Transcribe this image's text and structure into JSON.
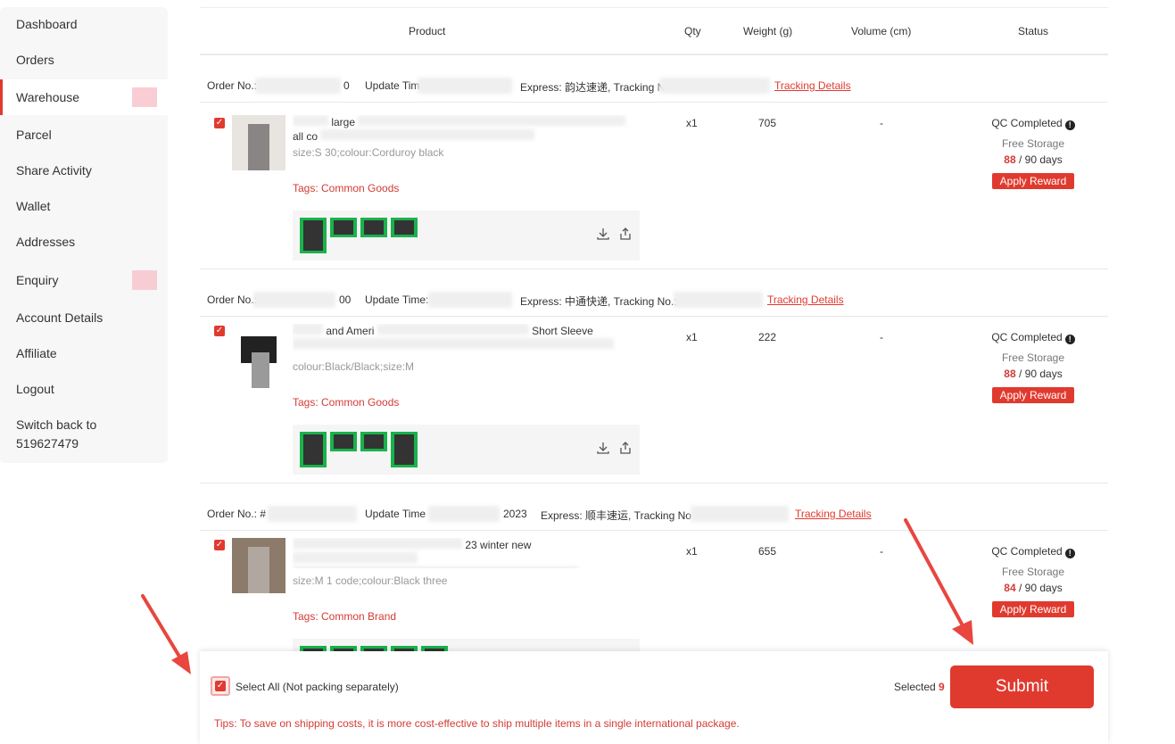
{
  "sidebar": {
    "items": [
      {
        "label": "Dashboard"
      },
      {
        "label": "Orders"
      },
      {
        "label": "Warehouse"
      },
      {
        "label": "Parcel"
      },
      {
        "label": "Share Activity"
      },
      {
        "label": "Wallet"
      },
      {
        "label": "Addresses"
      },
      {
        "label": "Enquiry"
      },
      {
        "label": "Account Details"
      },
      {
        "label": "Affiliate"
      },
      {
        "label": "Logout"
      },
      {
        "label": "Switch back to 519627479"
      }
    ]
  },
  "table": {
    "headers": {
      "product": "Product",
      "qty": "Qty",
      "weight": "Weight (g)",
      "volume": "Volume (cm)",
      "status": "Status"
    }
  },
  "orders": [
    {
      "order_no_label": "Order No.:",
      "order_no_tail": "0",
      "update_label": "Update Tim",
      "express": "Express: 韵达速递, Tracking N",
      "tracking_link": "Tracking Details",
      "product_title_visible": "large",
      "product_title_line2": "all co",
      "spec": "size:S 30;colour:Corduroy black",
      "tags": "Tags: Common Goods",
      "qty": "x1",
      "weight": "705",
      "volume": "-",
      "status": "QC Completed",
      "storage": "Free Storage",
      "days_used": "88",
      "days_total": " / 90 days",
      "apply_label": "Apply Reward"
    },
    {
      "order_no_label": "Order No.:",
      "order_no_tail": "00",
      "update_label": "Update Time:",
      "express": "Express: 中通快递, Tracking No.:",
      "tracking_link": "Tracking Details",
      "product_title_visible": "and Ameri",
      "product_title_line2": "Short Sleeve",
      "spec": "colour:Black/Black;size:M",
      "tags": "Tags: Common Goods",
      "qty": "x1",
      "weight": "222",
      "volume": "-",
      "status": "QC Completed",
      "storage": "Free Storage",
      "days_used": "88",
      "days_total": " / 90 days",
      "apply_label": "Apply Reward"
    },
    {
      "order_no_label": "Order No.: #",
      "order_no_tail": "",
      "update_label": "Update Time",
      "update_tail": "2023",
      "express": "Express: 顺丰速运, Tracking No",
      "tracking_link": "Tracking Details",
      "product_title_visible": "23 winter new",
      "product_title_line2": "",
      "spec": "size:M 1 code;colour:Black three",
      "tags": "Tags: Common Brand",
      "qty": "x1",
      "weight": "655",
      "volume": "-",
      "status": "QC Completed",
      "storage": "Free Storage",
      "days_used": "84",
      "days_total": " / 90 days",
      "apply_label": "Apply Reward"
    }
  ],
  "bottom_bar": {
    "select_all_label": "Select All (Not packing separately)",
    "selected_label": "Selected ",
    "selected_count": "9",
    "submit_label": "Submit",
    "tips": "Tips: To save on shipping costs, it is more cost-effective to ship multiple items in a single international package."
  },
  "colors": {
    "accent": "#e03a2f",
    "sidebar_bg": "#f7f7f8",
    "qc_green": "#19b24b"
  }
}
